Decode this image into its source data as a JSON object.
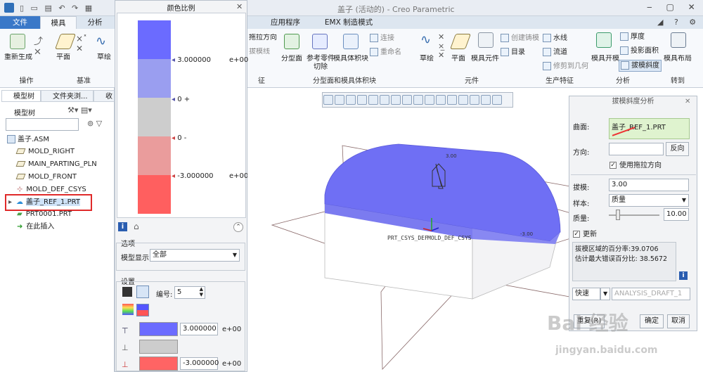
{
  "window": {
    "title": "盖子 (活动的) - Creo Parametric"
  },
  "ribbon_tabs": [
    "文件",
    "模具",
    "分析",
    "应用程序",
    "EMX 制造模式"
  ],
  "ribbon": {
    "left_buttons": {
      "regenerate": "重新生成",
      "plane": "平面",
      "sketch": "草绘"
    },
    "left_groups": {
      "operations": "操作",
      "datum": "基准"
    },
    "mid_items": {
      "drag_dir": "拖拉方向",
      "blend": "拔模线",
      "connect": "连接",
      "rename": "重命名",
      "parting_surface": "分型面",
      "ref_part_cut": "参考零件切除",
      "mold_volume": "模具体积块"
    },
    "mid_group": "分型面和模具体积块",
    "feature_group_suffix": "征",
    "right_items": {
      "sketch": "草绘",
      "plane": "平面",
      "mold_component": "模具元件",
      "create_cast": "创建铸模",
      "catalog": "目录",
      "waterline": "水线",
      "runner": "流道",
      "trim_geom": "修剪到几何",
      "mold_open": "模具开模",
      "thickness": "厚度",
      "projected_area": "投影面积",
      "draft_check": "拔模斜度",
      "mold_layout": "模具布局"
    },
    "right_groups": {
      "component": "元件",
      "production": "生产特征",
      "analysis": "分析",
      "goto": "转到"
    }
  },
  "left_panel": {
    "tabs": [
      "模型树",
      "文件夹浏...",
      "收"
    ],
    "tree_label": "模型树",
    "items": [
      "盖子.ASM",
      "MOLD_RIGHT",
      "MAIN_PARTING_PLN",
      "MOLD_FRONT",
      "MOLD_DEF_CSYS",
      "盖子_REF_1.PRT",
      "PRT0001.PRT",
      "在此插入"
    ]
  },
  "color_scale": {
    "title": "颜色比例",
    "bands": [
      "#6b6bff",
      "#9a9ef0",
      "#cdcdcd",
      "#ea9c9c",
      "#ff5f5f"
    ],
    "labels": [
      {
        "value": "3.000000",
        "exp": "e+00"
      },
      {
        "value": "0 +",
        "exp": ""
      },
      {
        "value": "0 -",
        "exp": ""
      },
      {
        "value": "-3.000000",
        "exp": "e+00"
      }
    ],
    "options_title": "选项",
    "model_display_label": "模型显示:",
    "model_display_value": "全部",
    "settings_title": "设置",
    "number_label": "编号:",
    "number_value": "5",
    "rows": [
      {
        "color": "#6b6bff",
        "value": "3.000000",
        "exp": "e+00"
      },
      {
        "color": "#cdcdcd",
        "value": "",
        "exp": ""
      },
      {
        "color": "#ff6464",
        "value": "-3.000000",
        "exp": "e+00"
      }
    ]
  },
  "viewport": {
    "csys_label": "PRT_CSYS_DEF",
    "mold_csys_label": "MOLD_DEF_CSYS",
    "small_label_1": "3.00",
    "small_label_2": "-3.00"
  },
  "draft_dialog": {
    "title": "拔模斜度分析",
    "surface_label": "曲面:",
    "surface_value": "盖子_REF_1.PRT",
    "direction_label": "方向:",
    "reverse_button": "反向",
    "use_drag_dir": "使用拖拉方向",
    "draft_label": "拔模:",
    "draft_value": "3.00",
    "sample_label": "样本:",
    "sample_value": "质量",
    "quality_label": "质量:",
    "quality_value": "10.00",
    "update_label": "更新",
    "result_line1": "拔模区域的百分率:39.0706",
    "result_line2": "估计最大错误百分比: 38.5672",
    "quick_label": "快速",
    "analysis_name": "ANALYSIS_DRAFT_1",
    "repeat_button": "重复(R)",
    "confirm_button": "确定",
    "cancel_button": "取消"
  },
  "watermark": {
    "line1": "Bai 经验",
    "line2": "jingyan.baidu.com"
  }
}
